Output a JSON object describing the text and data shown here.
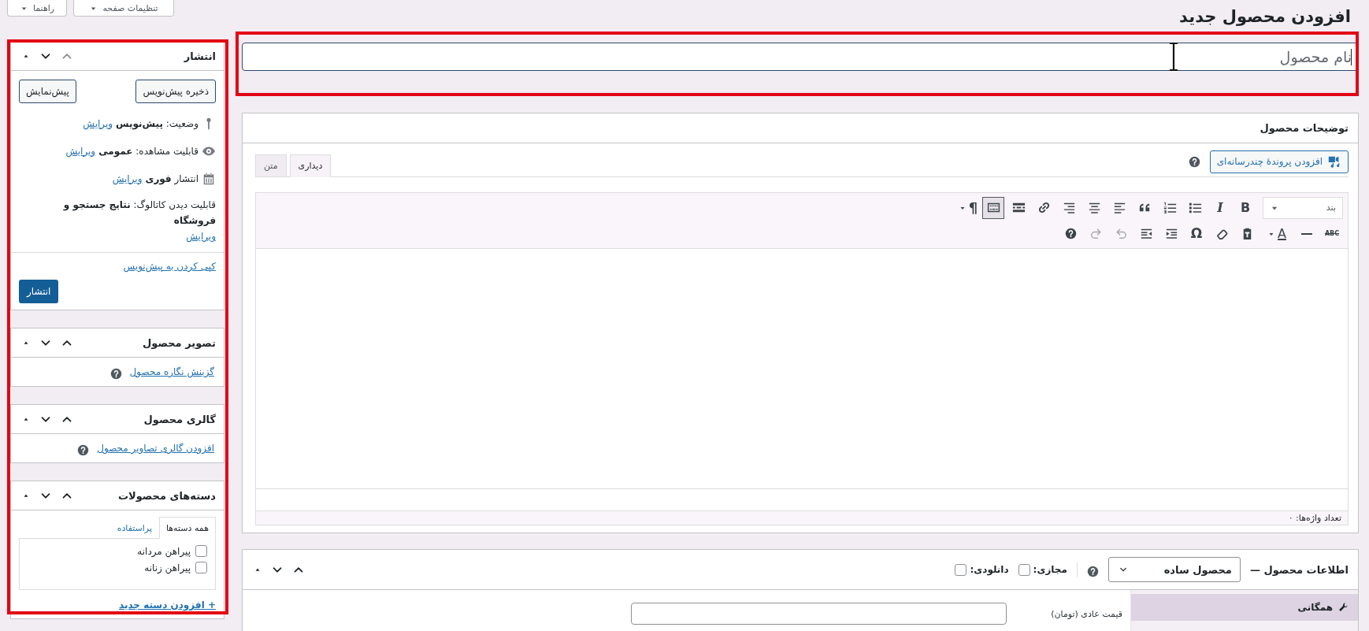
{
  "header_buttons": [
    {
      "label": "تنظیمات صفحه"
    },
    {
      "label": "راهنما"
    }
  ],
  "page_title": "افزودن محصول جدید",
  "title_field": {
    "placeholder": "نام محصول"
  },
  "description": {
    "title": "توضیحات محصول",
    "media_button": "افزودن پروندهٔ چندرسانه‌ای",
    "tabs": [
      {
        "label": "دیداری",
        "selected": true
      },
      {
        "label": "متن",
        "selected": false
      }
    ],
    "format_select": "بند",
    "toolbar": [
      [
        {
          "kind": "bold",
          "text": "B",
          "pressed": false,
          "disabled": false
        },
        {
          "kind": "italic",
          "text": "I",
          "pressed": false,
          "disabled": false
        },
        {
          "kind": "bullets",
          "pressed": false,
          "disabled": false
        },
        {
          "kind": "numbers",
          "pressed": false,
          "disabled": false
        },
        {
          "kind": "quote",
          "pressed": false,
          "disabled": false
        },
        {
          "kind": "align-left",
          "pressed": false,
          "disabled": false
        },
        {
          "kind": "align-center",
          "pressed": false,
          "disabled": false
        },
        {
          "kind": "align-right",
          "pressed": false,
          "disabled": false
        },
        {
          "kind": "link",
          "pressed": false,
          "disabled": false
        },
        {
          "kind": "more",
          "pressed": false,
          "disabled": false
        },
        {
          "kind": "toggle",
          "pressed": true,
          "disabled": false
        },
        {
          "kind": "rtl",
          "text": "¶",
          "pressed": false,
          "disabled": false
        }
      ],
      [
        {
          "kind": "strike",
          "text": "ABC",
          "pressed": false,
          "disabled": false
        },
        {
          "kind": "hr",
          "pressed": false,
          "disabled": false
        },
        {
          "kind": "color",
          "text": "A",
          "pressed": false,
          "disabled": false
        },
        {
          "kind": "paste",
          "pressed": false,
          "disabled": false
        },
        {
          "kind": "eraser",
          "pressed": false,
          "disabled": false
        },
        {
          "kind": "omega",
          "text": "Ω",
          "pressed": false,
          "disabled": false
        },
        {
          "kind": "indent",
          "pressed": false,
          "disabled": false
        },
        {
          "kind": "outdent",
          "pressed": false,
          "disabled": false
        },
        {
          "kind": "undo",
          "pressed": false,
          "disabled": true
        },
        {
          "kind": "redo",
          "pressed": false,
          "disabled": true
        },
        {
          "kind": "help",
          "pressed": false,
          "disabled": false
        }
      ]
    ],
    "word_count": "تعداد واژه‌ها: ۰"
  },
  "product_data": {
    "title": "اطلاعات محصول —",
    "type_select": "محصول ساده",
    "options": [
      {
        "label": "مجازی:",
        "checked": false
      },
      {
        "label": "دانلودی:",
        "checked": false
      }
    ],
    "tabs": [
      {
        "label": "همگانی",
        "selected": true
      }
    ],
    "fields": [
      {
        "label": "قیمت عادی (تومان)"
      }
    ]
  },
  "publish": {
    "title": "انتشار",
    "save_draft": "ذخیره پیش‌نویس",
    "preview": "پیش‌نمایش",
    "rows": [
      {
        "kind": "status",
        "text": "وضعیت: **پیش‌نویس**",
        "link": "ویرایش"
      },
      {
        "kind": "visibility",
        "text": "قابلیت مشاهده: **عمومی**",
        "link": "ویرایش"
      },
      {
        "kind": "schedule",
        "text": "انتشار **فوری**",
        "link": "ویرایش"
      },
      {
        "kind": "catalog",
        "text": "قابلیت دیدن کاتالوگ: **نتایج جستجو و فروشگاه**",
        "link": "ویرایش"
      }
    ],
    "copy_link": "کپی کردن به پیش‌نویس",
    "publish_button": "انتشار"
  },
  "image_box": {
    "title": "تصویر محصول",
    "link": "گزینش نگاره محصول"
  },
  "gallery_box": {
    "title": "گالری محصول",
    "link": "افزودن گالری تصاویر محصول"
  },
  "categories": {
    "title": "دسته‌های محصولات",
    "tabs": [
      {
        "label": "همه دسته‌ها",
        "selected": true
      },
      {
        "label": "پراستفاده",
        "selected": false
      }
    ],
    "items": [
      {
        "label": "پیراهن مردانه",
        "checked": false
      },
      {
        "label": "پیراهن زنانه",
        "checked": false
      }
    ],
    "add_link": "+ افزودن دسته جدید"
  }
}
